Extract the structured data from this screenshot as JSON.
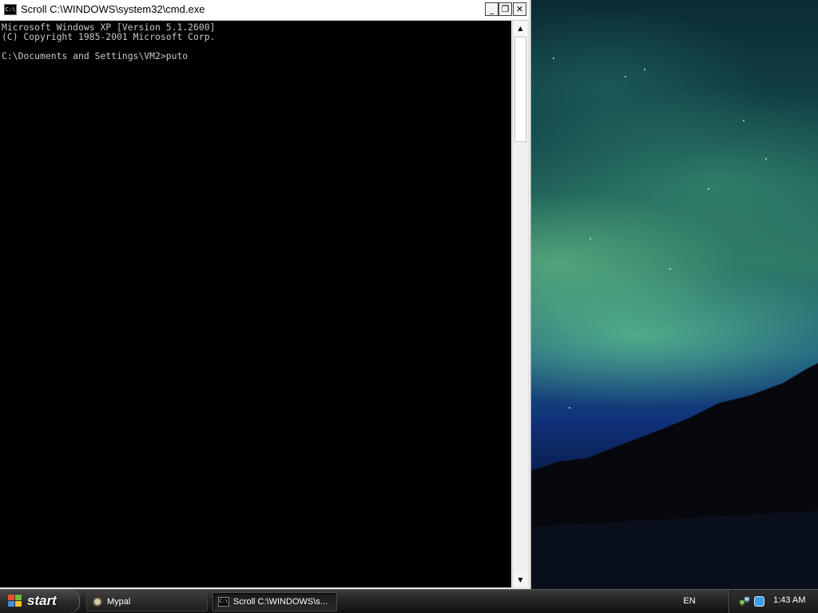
{
  "window": {
    "title": "Scroll C:\\WINDOWS\\system32\\cmd.exe",
    "icon_label": "C:\\",
    "minimize_glyph": "_",
    "maximize_glyph": "❐",
    "close_glyph": "✕"
  },
  "console": {
    "lines": [
      "Microsoft Windows XP [Version 5.1.2600]",
      "(C) Copyright 1985-2001 Microsoft Corp.",
      "",
      "C:\\Documents and Settings\\VM2>puto"
    ],
    "background": "#000000",
    "foreground": "#c8c8c8"
  },
  "scrollbar": {
    "up_glyph": "▲",
    "down_glyph": "▼"
  },
  "taskbar": {
    "start_label": "start",
    "tasks": [
      {
        "label": "Mypal",
        "icon": "mypal-icon",
        "active": false
      },
      {
        "label": "Scroll C:\\WINDOWS\\s...",
        "icon": "cmd-icon",
        "active": true
      }
    ],
    "language": "EN",
    "clock": "1:43 AM"
  },
  "tray_icons": [
    "network-icon",
    "messenger-icon"
  ],
  "colors": {
    "taskbar": "#262626",
    "title_bar": "#ffffff"
  }
}
